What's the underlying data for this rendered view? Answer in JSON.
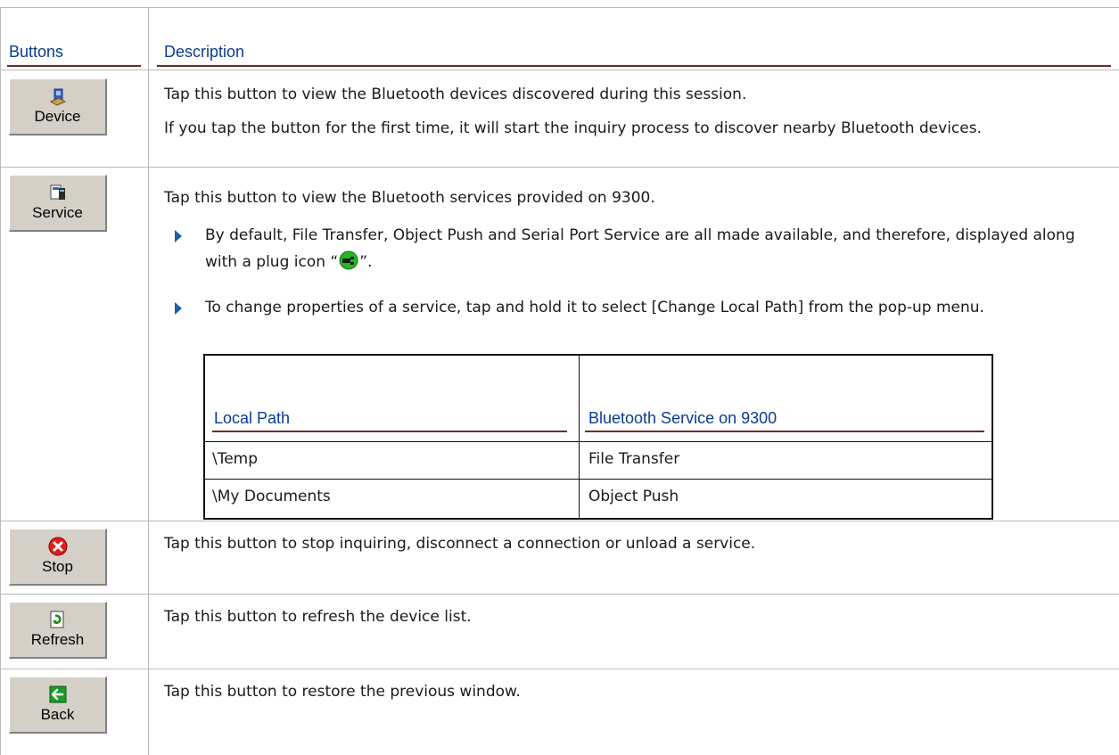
{
  "headers": {
    "buttons": "Buttons",
    "description": "Description"
  },
  "rows": [
    {
      "button_label": "Device",
      "icon": "device-icon",
      "paragraphs": [
        "Tap this button to view the Bluetooth devices discovered during this session.",
        "If you tap the button for the first time, it will start the inquiry process to discover nearby Bluetooth devices."
      ]
    },
    {
      "button_label": "Service",
      "icon": "service-icon",
      "intro": "Tap this button to view the Bluetooth services provided on 9300.",
      "bullets": [
        {
          "text_before": "By default, File Transfer, Object Push and Serial Port Service are all made available, and therefore, displayed along with a plug icon “",
          "text_after": "”."
        },
        {
          "text": "To change properties of a service, tap and hold it to select [Change Local Path] from the pop-up menu."
        }
      ],
      "subtable": {
        "headers": [
          "Local Path",
          "Bluetooth Service on 9300"
        ],
        "rows": [
          [
            "\\Temp",
            "File Transfer"
          ],
          [
            "\\My Documents",
            "Object Push"
          ]
        ]
      }
    },
    {
      "button_label": "Stop",
      "icon": "stop-icon",
      "paragraphs": [
        "Tap this button to stop inquiring, disconnect a connection or unload a service."
      ]
    },
    {
      "button_label": "Refresh",
      "icon": "refresh-icon",
      "paragraphs": [
        "Tap this button to refresh the device list."
      ]
    },
    {
      "button_label": "Back",
      "icon": "back-icon",
      "paragraphs": [
        "Tap this button to restore the previous window."
      ]
    }
  ],
  "colors": {
    "header_text": "#0b3b8f",
    "bullet_arrow": "#1f5fa8",
    "button_face": "#d4d0c8"
  }
}
